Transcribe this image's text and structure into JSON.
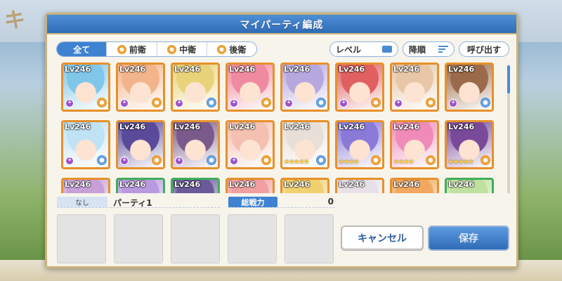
{
  "dialog": {
    "title": "マイパーティ編成"
  },
  "filters": {
    "tabs": [
      {
        "label": "全て",
        "active": true
      },
      {
        "label": "前衛",
        "active": false
      },
      {
        "label": "中衛",
        "active": false
      },
      {
        "label": "後衛",
        "active": false
      }
    ],
    "level_label": "レベル",
    "order_label": "降順",
    "call_label": "呼び出す"
  },
  "characters": [
    {
      "level": "Lv246",
      "hue": "#7fc6e8",
      "style": "rank",
      "pos": "orange"
    },
    {
      "level": "Lv246",
      "hue": "#f2b48a",
      "style": "rank",
      "pos": "orange"
    },
    {
      "level": "Lv246",
      "hue": "#e8d37a",
      "style": "rank",
      "pos": "blue"
    },
    {
      "level": "Lv246",
      "hue": "#f08aa0",
      "style": "rank",
      "pos": "orange"
    },
    {
      "level": "Lv246",
      "hue": "#b6a8de",
      "style": "rank",
      "pos": "blue"
    },
    {
      "level": "Lv246",
      "hue": "#e06060",
      "style": "rank",
      "pos": "orange"
    },
    {
      "level": "Lv246",
      "hue": "#e8c7a8",
      "style": "rank",
      "pos": "orange"
    },
    {
      "level": "Lv246",
      "hue": "#9a6a4a",
      "style": "rank",
      "pos": "blue"
    },
    {
      "level": "Lv246",
      "hue": "#bfe2f5",
      "style": "rank",
      "pos": "blue"
    },
    {
      "level": "Lv246",
      "hue": "#5a4a9a",
      "style": "rank",
      "pos": "orange"
    },
    {
      "level": "Lv246",
      "hue": "#7a5a8a",
      "style": "rank",
      "pos": "blue"
    },
    {
      "level": "Lv246",
      "hue": "#f4c0b0",
      "style": "rank",
      "pos": "orange"
    },
    {
      "level": "Lv246",
      "hue": "#e8e0d8",
      "style": "stars",
      "stars": "★★★★★",
      "pos": "blue"
    },
    {
      "level": "Lv246",
      "hue": "#8a7ad8",
      "style": "stars",
      "stars": "★★★★",
      "pos": "orange"
    },
    {
      "level": "Lv246",
      "hue": "#f08ab8",
      "style": "stars",
      "stars": "★★★★",
      "pos": "orange"
    },
    {
      "level": "Lv246",
      "hue": "#7a4a9a",
      "style": "stars",
      "stars": "★★★★★",
      "pos": "orange"
    },
    {
      "level": "Lv246",
      "hue": "#c7a0d8",
      "style": "plain",
      "pos": "none",
      "frame": "orange"
    },
    {
      "level": "Lv246",
      "hue": "#b99ae0",
      "style": "plain",
      "pos": "none",
      "frame": "green"
    },
    {
      "level": "Lv246",
      "hue": "#6a5a9a",
      "style": "plain",
      "pos": "none",
      "frame": "green"
    },
    {
      "level": "Lv246",
      "hue": "#f0a0a0",
      "style": "plain",
      "pos": "none",
      "frame": "orange"
    },
    {
      "level": "Lv246",
      "hue": "#f0d070",
      "style": "plain",
      "pos": "none",
      "frame": "orange"
    },
    {
      "level": "Lv246",
      "hue": "#e8e0e8",
      "style": "plain",
      "pos": "none",
      "frame": "orange"
    },
    {
      "level": "Lv246",
      "hue": "#f2a860",
      "style": "plain",
      "pos": "none",
      "frame": "orange"
    },
    {
      "level": "Lv246",
      "hue": "#c0e0a0",
      "style": "plain",
      "pos": "none",
      "frame": "green"
    }
  ],
  "party": {
    "tag": "なし",
    "name": "パーティ1",
    "power_label": "総戦力",
    "power_value": "0"
  },
  "buttons": {
    "cancel": "キャンセル",
    "save": "保存"
  },
  "background": {
    "logo": "キ"
  }
}
